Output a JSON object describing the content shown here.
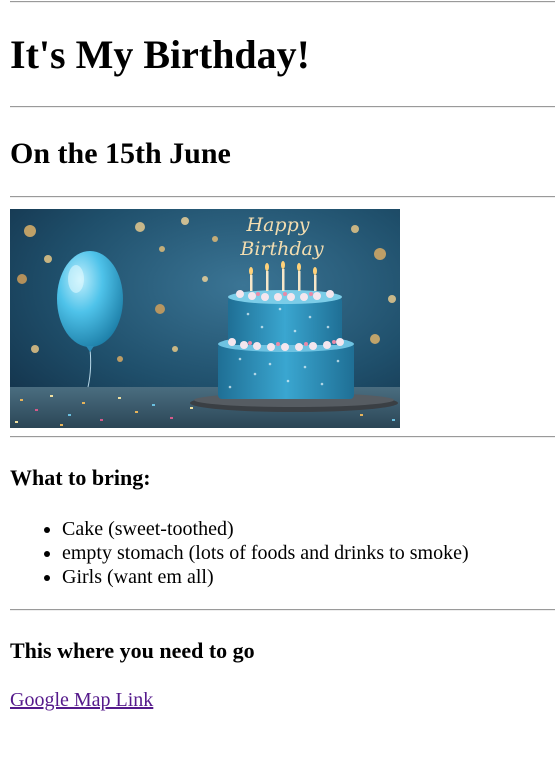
{
  "page": {
    "title": "It's My Birthday!",
    "date_heading": "On the 15th June",
    "hero_image": {
      "alt": "Happy Birthday cake with balloon",
      "cake_topper_line1": "Happy",
      "cake_topper_line2": "Birthday",
      "colors": {
        "background": "#1f4f6b",
        "balloon": "#4fc3ea",
        "cake": "#2f8fb8",
        "confetti": "#e6b35a"
      }
    },
    "bring": {
      "heading": "What to bring:",
      "items": [
        "Cake (sweet-toothed)",
        "empty stomach (lots of foods and drinks to smoke)",
        "Girls (want em all)"
      ]
    },
    "location": {
      "heading": "This where you need to go",
      "link_text": "Google Map Link"
    },
    "colors": {
      "link_visited": "#551a8b",
      "rule": "#9a9a9a"
    }
  }
}
